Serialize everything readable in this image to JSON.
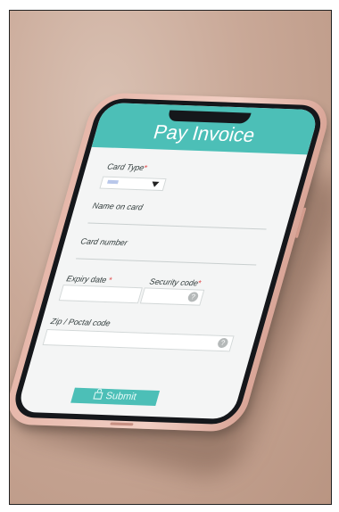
{
  "form": {
    "title": "Pay Invoice",
    "card_type_label": "Card Type",
    "required_mark": "*",
    "name_label": "Name on card",
    "card_number_label": "Card number",
    "expiry_label": "Expiry date",
    "security_label": "Security code",
    "zip_label": "Zip / Poctal code",
    "help_icon": "?",
    "submit_label": "Submit"
  },
  "colors": {
    "accent": "#4cbfb7",
    "case": "#f2cfc4",
    "surface": "#c9a897"
  },
  "icons": [
    "lock-icon",
    "help-icon",
    "chevron-down-icon"
  ]
}
